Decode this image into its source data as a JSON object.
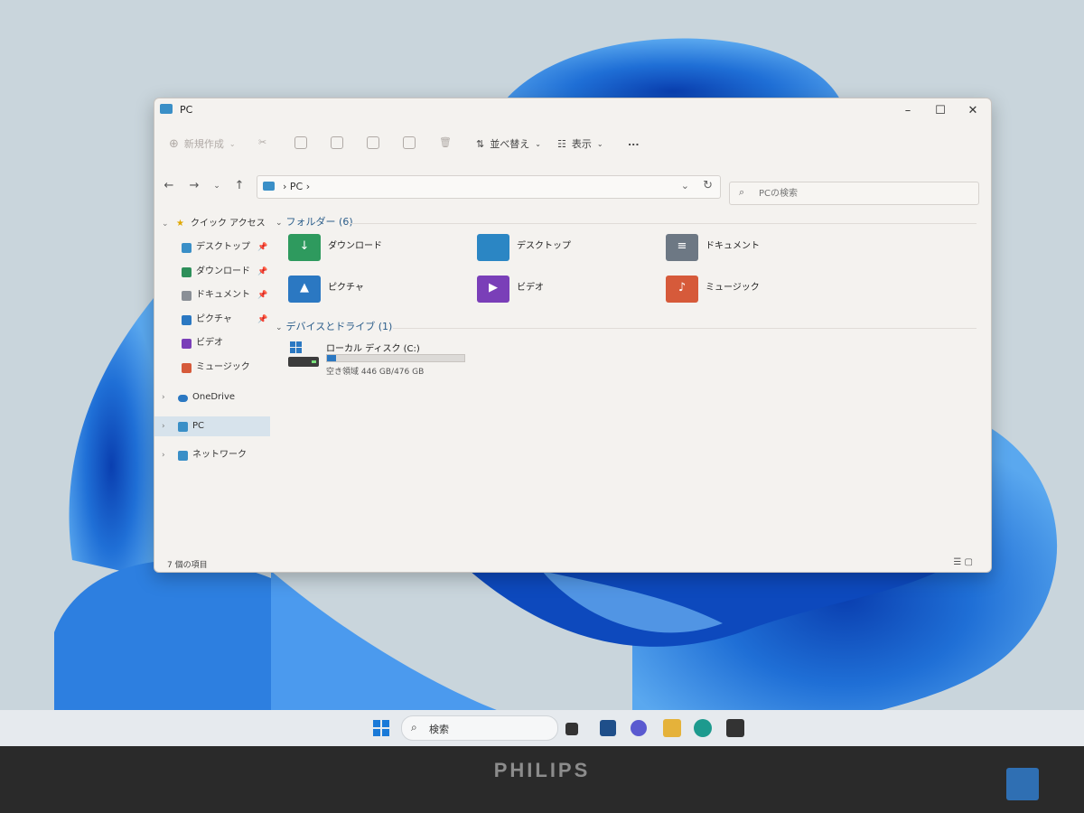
{
  "window": {
    "title": "PC",
    "controls": {
      "minimize": "–",
      "maximize": "☐",
      "close": "✕"
    }
  },
  "toolbar": {
    "new_label": "新規作成",
    "sort_label": "並べ替え",
    "view_label": "表示",
    "more_label": "..."
  },
  "address": {
    "path": "PC",
    "search_placeholder": "PCの検索"
  },
  "sidebar": {
    "quick_access": "クイック アクセス",
    "items": [
      {
        "label": "デスクトップ",
        "pinned": true,
        "icon": "desktop-icon",
        "color": "#3a8fc7"
      },
      {
        "label": "ダウンロード",
        "pinned": true,
        "icon": "download-icon",
        "color": "#2e8f5a"
      },
      {
        "label": "ドキュメント",
        "pinned": true,
        "icon": "document-icon",
        "color": "#8a8f96"
      },
      {
        "label": "ピクチャ",
        "pinned": true,
        "icon": "pictures-icon",
        "color": "#2b78c2"
      },
      {
        "label": "ビデオ",
        "pinned": false,
        "icon": "video-icon",
        "color": "#7a3fb8"
      },
      {
        "label": "ミュージック",
        "pinned": false,
        "icon": "music-icon",
        "color": "#d65a3a"
      }
    ],
    "onedrive": "OneDrive",
    "pc": "PC",
    "network": "ネットワーク"
  },
  "content": {
    "folders_header": "フォルダー (6)",
    "folders": [
      {
        "label": "ダウンロード",
        "icon": "download-folder-icon",
        "color": "#2e9a5e"
      },
      {
        "label": "デスクトップ",
        "icon": "desktop-folder-icon",
        "color": "#2b86c4"
      },
      {
        "label": "ドキュメント",
        "icon": "documents-folder-icon",
        "color": "#6d7884"
      },
      {
        "label": "ピクチャ",
        "icon": "pictures-folder-icon",
        "color": "#2b78c2"
      },
      {
        "label": "ビデオ",
        "icon": "videos-folder-icon",
        "color": "#7a3fb8"
      },
      {
        "label": "ミュージック",
        "icon": "music-folder-icon",
        "color": "#d65a3a"
      }
    ],
    "drives_header": "デバイスとドライブ (1)",
    "drive": {
      "label": "ローカル ディスク (C:)",
      "free_text": "空き領域 446 GB/476 GB",
      "used_fraction": 0.063
    }
  },
  "status": {
    "count": "7 個の項目"
  },
  "taskbar": {
    "search_label": "検索"
  },
  "monitor": {
    "brand": "PHILIPS"
  },
  "colors": {
    "accent": "#2b78c2",
    "window_bg": "#f4f2ef",
    "wallpaper_blue": "#1f6fd6"
  }
}
